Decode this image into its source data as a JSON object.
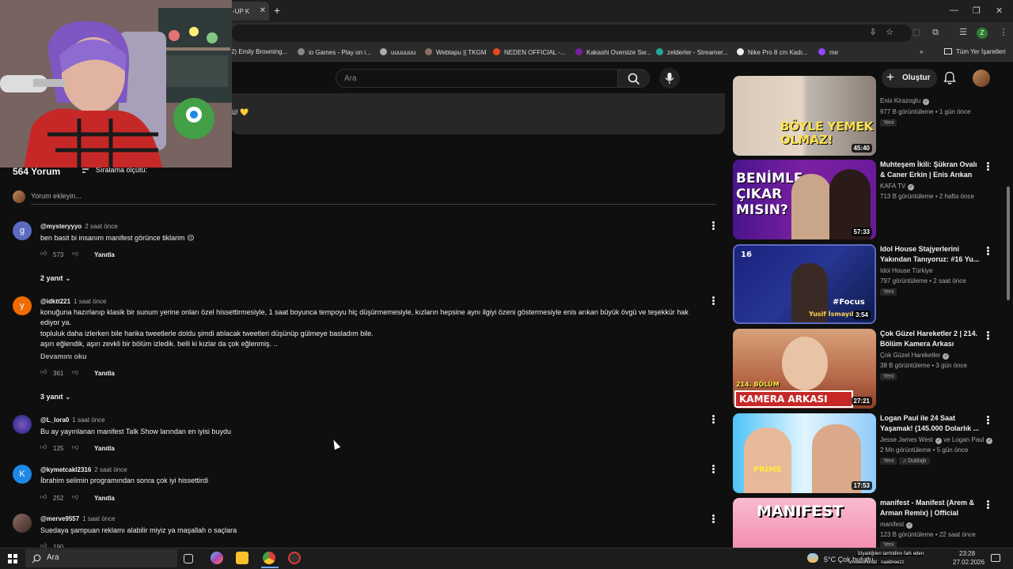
{
  "browser": {
    "active_tab_label": "-UP K",
    "bookmarks": [
      "2) Emily Browning...",
      "io Games - Play on i...",
      "uuuuuuu",
      "Webtapu || TKGM",
      "NEDEN OFFICIAL -...",
      "Kakashi Oversize Sw...",
      "zelderler - Streamer...",
      "Nike Pro 8 cm Kadı...",
      "me"
    ],
    "all_bookmarks_label": "Tüm Yer İşaretleri",
    "profile_initial": "Z"
  },
  "header": {
    "search_placeholder": "Ara",
    "create_label": "Oluştur"
  },
  "description": {
    "snippet": "ü! 💛"
  },
  "comments": {
    "count_label": "564 Yorum",
    "sort_label": "Sıralama ölçütü:",
    "add_placeholder": "Yorum ekleyin...",
    "reply_label": "Yanıtla",
    "read_more_label": "Devamını oku",
    "items": [
      {
        "initial": "g",
        "user": "@mysteryyyo",
        "time": "2 saat önce",
        "lines": [
          "ben basit bi insanım manifest görünce tiklarim 😔"
        ],
        "likes": "573",
        "replies_label": "2 yanıt"
      },
      {
        "initial": "y",
        "user": "@idktt221",
        "time": "1 saat önce",
        "lines": [
          "konuğuna hazırlanıp klasik bir sunum yerine onları özel hissettirmesiyle, 1 saat boyunca tempoyu hiç düşürmemesiyle, kızların hepsine aynı ilgiyi özeni göstermesiyle enis arıkan büyük övgü ve teşekkür hak",
          "ediyor ya.",
          "topluluk daha izlerken bile harika tweetlerle doldu şimdi atılacak tweetleri düşünüp gülmeye basladım bile.",
          "aşırı eğlendik, aşırı zevkli bir bölüm izledik. belli ki kızlar da çok eğlenmiş. .."
        ],
        "likes": "361",
        "replies_label": "3 yanıt"
      },
      {
        "initial": "",
        "user": "@L_lora0",
        "time": "1 saat önce",
        "lines": [
          "Bu ay yayınlanan manifest Talk Show larından en iyisi buydu"
        ],
        "likes": "125"
      },
      {
        "initial": "K",
        "user": "@kymetcakl2316",
        "time": "2 saat önce",
        "lines": [
          "İbrahim selimin programından sonra çok iyi hissettirdi"
        ],
        "likes": "252"
      },
      {
        "initial": "",
        "user": "@merve9557",
        "time": "1 saat önce",
        "lines": [
          "Suedaya şampuan reklamı alabilir miyiz ya maşallah o saçlara"
        ],
        "likes": "190"
      }
    ]
  },
  "recommended": [
    {
      "title": "",
      "channel": "Enis Kirazoglu",
      "views": "977 B görüntüleme",
      "age": "1 gün önce",
      "badge": "Yeni",
      "duration": "45:40",
      "thumb_text": "BÖYLE YEMEK OLMAZ!"
    },
    {
      "title": "Muhteşem İkili: Şükran Ovalı & Caner Erkin | Enis Arıkan İl...",
      "channel": "KAFA TV",
      "views": "713 B görüntüleme",
      "age": "2 hafta önce",
      "duration": "57:33",
      "thumb_text": "BENİMLE ÇIKAR MISIN?"
    },
    {
      "title": "Idol House Stajyerlerini Yakından Tanıyoruz: #16 Yu...",
      "channel": "Idol House Türkiye",
      "views": "797 görüntüleme",
      "age": "2 saat önce",
      "badge": "Yeni",
      "duration": "3:54",
      "thumb_text": "#Focus",
      "thumb_num": "16",
      "thumb_name": "Yusif İsmayıl"
    },
    {
      "title": "Çok Güzel Hareketler 2 | 214. Bölüm Kamera Arkası",
      "channel": "Çok Güzel Hareketler",
      "views": "38 B görüntüleme",
      "age": "3 gün önce",
      "badge": "Yeni",
      "duration": "27:21",
      "thumb_text": "KAMERA ARKASI",
      "thumb_sub": "214. BÖLÜM"
    },
    {
      "title": "Logan Paul ile 24 Saat Yaşamak! (145.000 Dolarlık ...",
      "channel": "Jesse James West",
      "channel_extra": "ve Logan Paul",
      "views": "2 Mn görüntüleme",
      "age": "5 gün önce",
      "badge": "Yeni",
      "badge2": "Dublajlı",
      "duration": "17:53",
      "thumb_text": "PRIME"
    },
    {
      "title": "manifest - Manifest (Arem & Arman Remix) | Official Lyric...",
      "channel": "manifest",
      "views": "123 B görüntüleme",
      "age": "22 saat önce",
      "badge": "Yeni",
      "thumb_text": "MANIFEST"
    }
  ],
  "taskbar": {
    "search_label": "Ara",
    "weather": "5°C  Çok bulutlu",
    "time": "23:28",
    "date": "27.02.2026",
    "chat_line1": ": İzlyadığılen tarrtıldlını fark eden",
    "chat_line2": "smokeoflordd : naeibreezz"
  }
}
